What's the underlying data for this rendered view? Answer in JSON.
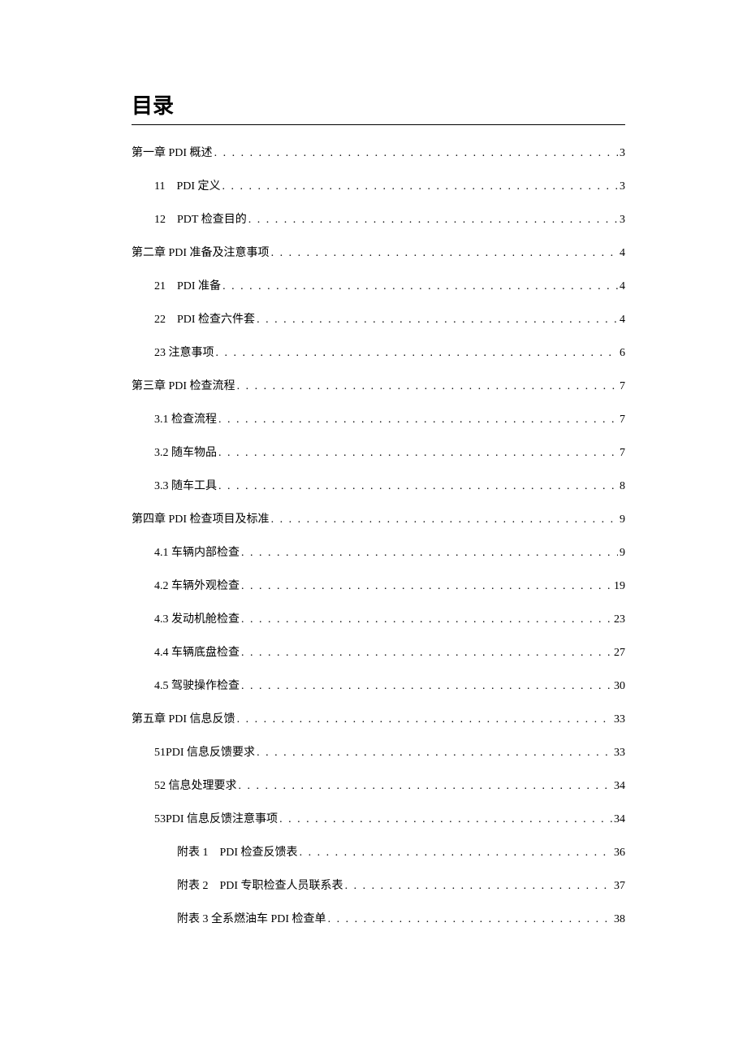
{
  "title": "目录",
  "entries": [
    {
      "level": 0,
      "label": "第一章 PDI 概述",
      "page": "3"
    },
    {
      "level": 1,
      "label": "11 PDI 定义",
      "page": "3"
    },
    {
      "level": 1,
      "label": "12 PDT 检查目的",
      "page": "3"
    },
    {
      "level": 0,
      "label": "第二章 PDI 准备及注意事项",
      "page": "4"
    },
    {
      "level": 1,
      "label": "21 PDI 准备",
      "page": "4"
    },
    {
      "level": 1,
      "label": "22 PDI 检查六件套",
      "page": "4"
    },
    {
      "level": 1,
      "label": "23 注意事项",
      "page": "6"
    },
    {
      "level": 0,
      "label": "第三章 PDI 检查流程",
      "page": "7"
    },
    {
      "level": 1,
      "label": "3.1 检查流程",
      "page": "7"
    },
    {
      "level": 1,
      "label": "3.2 随车物品",
      "page": "7"
    },
    {
      "level": 1,
      "label": "3.3 随车工具",
      "page": "8"
    },
    {
      "level": 0,
      "label": "第四章 PDI 检查项目及标准",
      "page": "9"
    },
    {
      "level": 1,
      "label": "4.1 车辆内部检查",
      "page": "9"
    },
    {
      "level": 1,
      "label": "4.2 车辆外观检查",
      "page": "19"
    },
    {
      "level": 1,
      "label": "4.3 发动机舱检查",
      "page": "23"
    },
    {
      "level": 1,
      "label": "4.4 车辆底盘检查",
      "page": "27"
    },
    {
      "level": 1,
      "label": "4.5 驾驶操作检查",
      "page": "30"
    },
    {
      "level": 0,
      "label": "第五章 PDI 信息反馈",
      "page": "33"
    },
    {
      "level": 1,
      "label": "51PDI 信息反馈要求",
      "page": "33"
    },
    {
      "level": 1,
      "label": "52 信息处理要求",
      "page": "34"
    },
    {
      "level": 1,
      "label": "53PDI 信息反馈注意事项",
      "page": "34"
    },
    {
      "level": 2,
      "label": "附表 1 PDI 检查反馈表",
      "page": "36"
    },
    {
      "level": 2,
      "label": "附表 2 PDI 专职检查人员联系表",
      "page": "37"
    },
    {
      "level": 2,
      "label": "附表 3 全系燃油车 PDI 检查单",
      "page": "38"
    }
  ]
}
